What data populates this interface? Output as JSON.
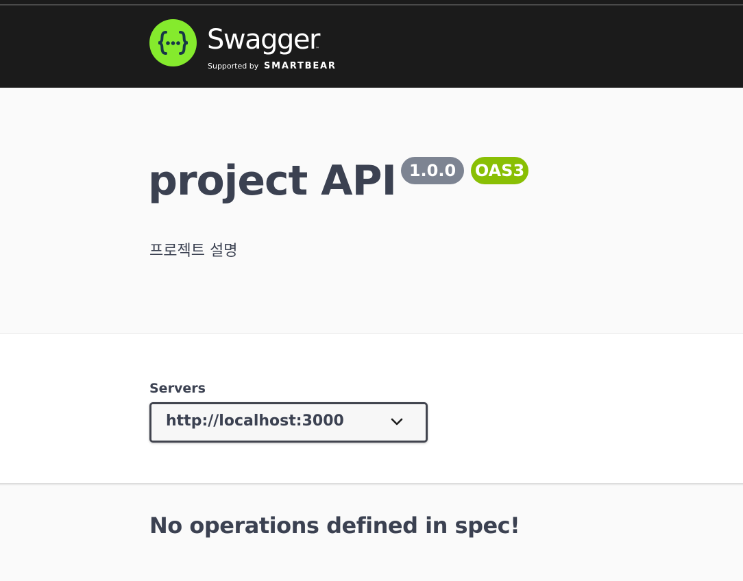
{
  "brand": {
    "name": "Swagger",
    "trademark": "™",
    "supported_by": "Supported by",
    "company": "SMARTBEAR",
    "logo_icon": "swagger-logo-icon",
    "logo_text": "{···}",
    "accent_color": "#85ea2d"
  },
  "info": {
    "title": "project API",
    "version": "1.0.0",
    "spec": "OAS3",
    "description": "프로젝트 설명",
    "version_badge_color": "#7d8492",
    "spec_badge_color": "#89bf04"
  },
  "servers": {
    "label": "Servers",
    "selected": "http://localhost:3000",
    "dropdown_icon": "chevron-down-icon"
  },
  "operations": {
    "empty_message": "No operations defined in spec!"
  }
}
